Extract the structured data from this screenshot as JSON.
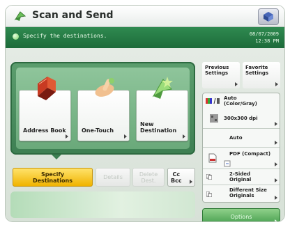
{
  "header": {
    "title": "Scan and Send"
  },
  "message": {
    "text": "Specify the destinations.",
    "date": "08/07/2009",
    "time": "12:38 PM"
  },
  "destinations": {
    "address_book": "Address Book",
    "one_touch": "One-Touch",
    "new_destination_line1": "New",
    "new_destination_line2": "Destination"
  },
  "tabs": {
    "specify_line1": "Specify",
    "specify_line2": "Destinations",
    "details": "Details",
    "delete_line1": "Delete",
    "delete_line2": "Dest.",
    "cc_line1": "Cc",
    "cc_line2": "Bcc"
  },
  "settings": {
    "previous_line1": "Previous",
    "previous_line2": "Settings",
    "favorite_line1": "Favorite",
    "favorite_line2": "Settings",
    "color_line1": "Auto",
    "color_line2": "(Color/Gray)",
    "resolution": "300x300 dpi",
    "size": "Auto",
    "format": "PDF (Compact)",
    "sided_line1": "2-Sided",
    "sided_line2": "Original",
    "diff_line1": "Different Size",
    "diff_line2": "Originals",
    "options": "Options"
  },
  "colors": {
    "accent_green": "#2f8a50",
    "highlight_yellow": "#f0b300"
  }
}
